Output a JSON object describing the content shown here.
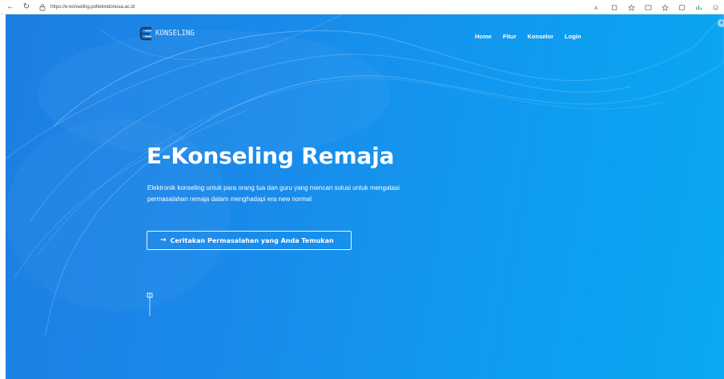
{
  "browser": {
    "url": "https://e-konseling.poltekindonusa.ac.id"
  },
  "nav": {
    "logo_text": "KONSELING",
    "items": [
      {
        "label": "Home"
      },
      {
        "label": "Fitur"
      },
      {
        "label": "Konselor"
      },
      {
        "label": "Login"
      }
    ]
  },
  "hero": {
    "title": "E-Konseling Remaja",
    "description": "Elektronik konseling untuk para orang tua dan guru yang mencari solusi untuk mengatasi permasalahan remaja dalam menghadapi era new normal",
    "cta_label": "Ceritakan Permasalahan yang Anda Temukan"
  },
  "icons": {
    "back": "back-arrow-icon",
    "refresh": "refresh-icon",
    "lock": "lock-icon",
    "cta_arrow": "arrow-right-icon",
    "scroll": "mouse-scroll-icon"
  },
  "colors": {
    "hero_start": "#1c7fe2",
    "hero_end": "#0aa8f2",
    "text": "#ffffff"
  }
}
